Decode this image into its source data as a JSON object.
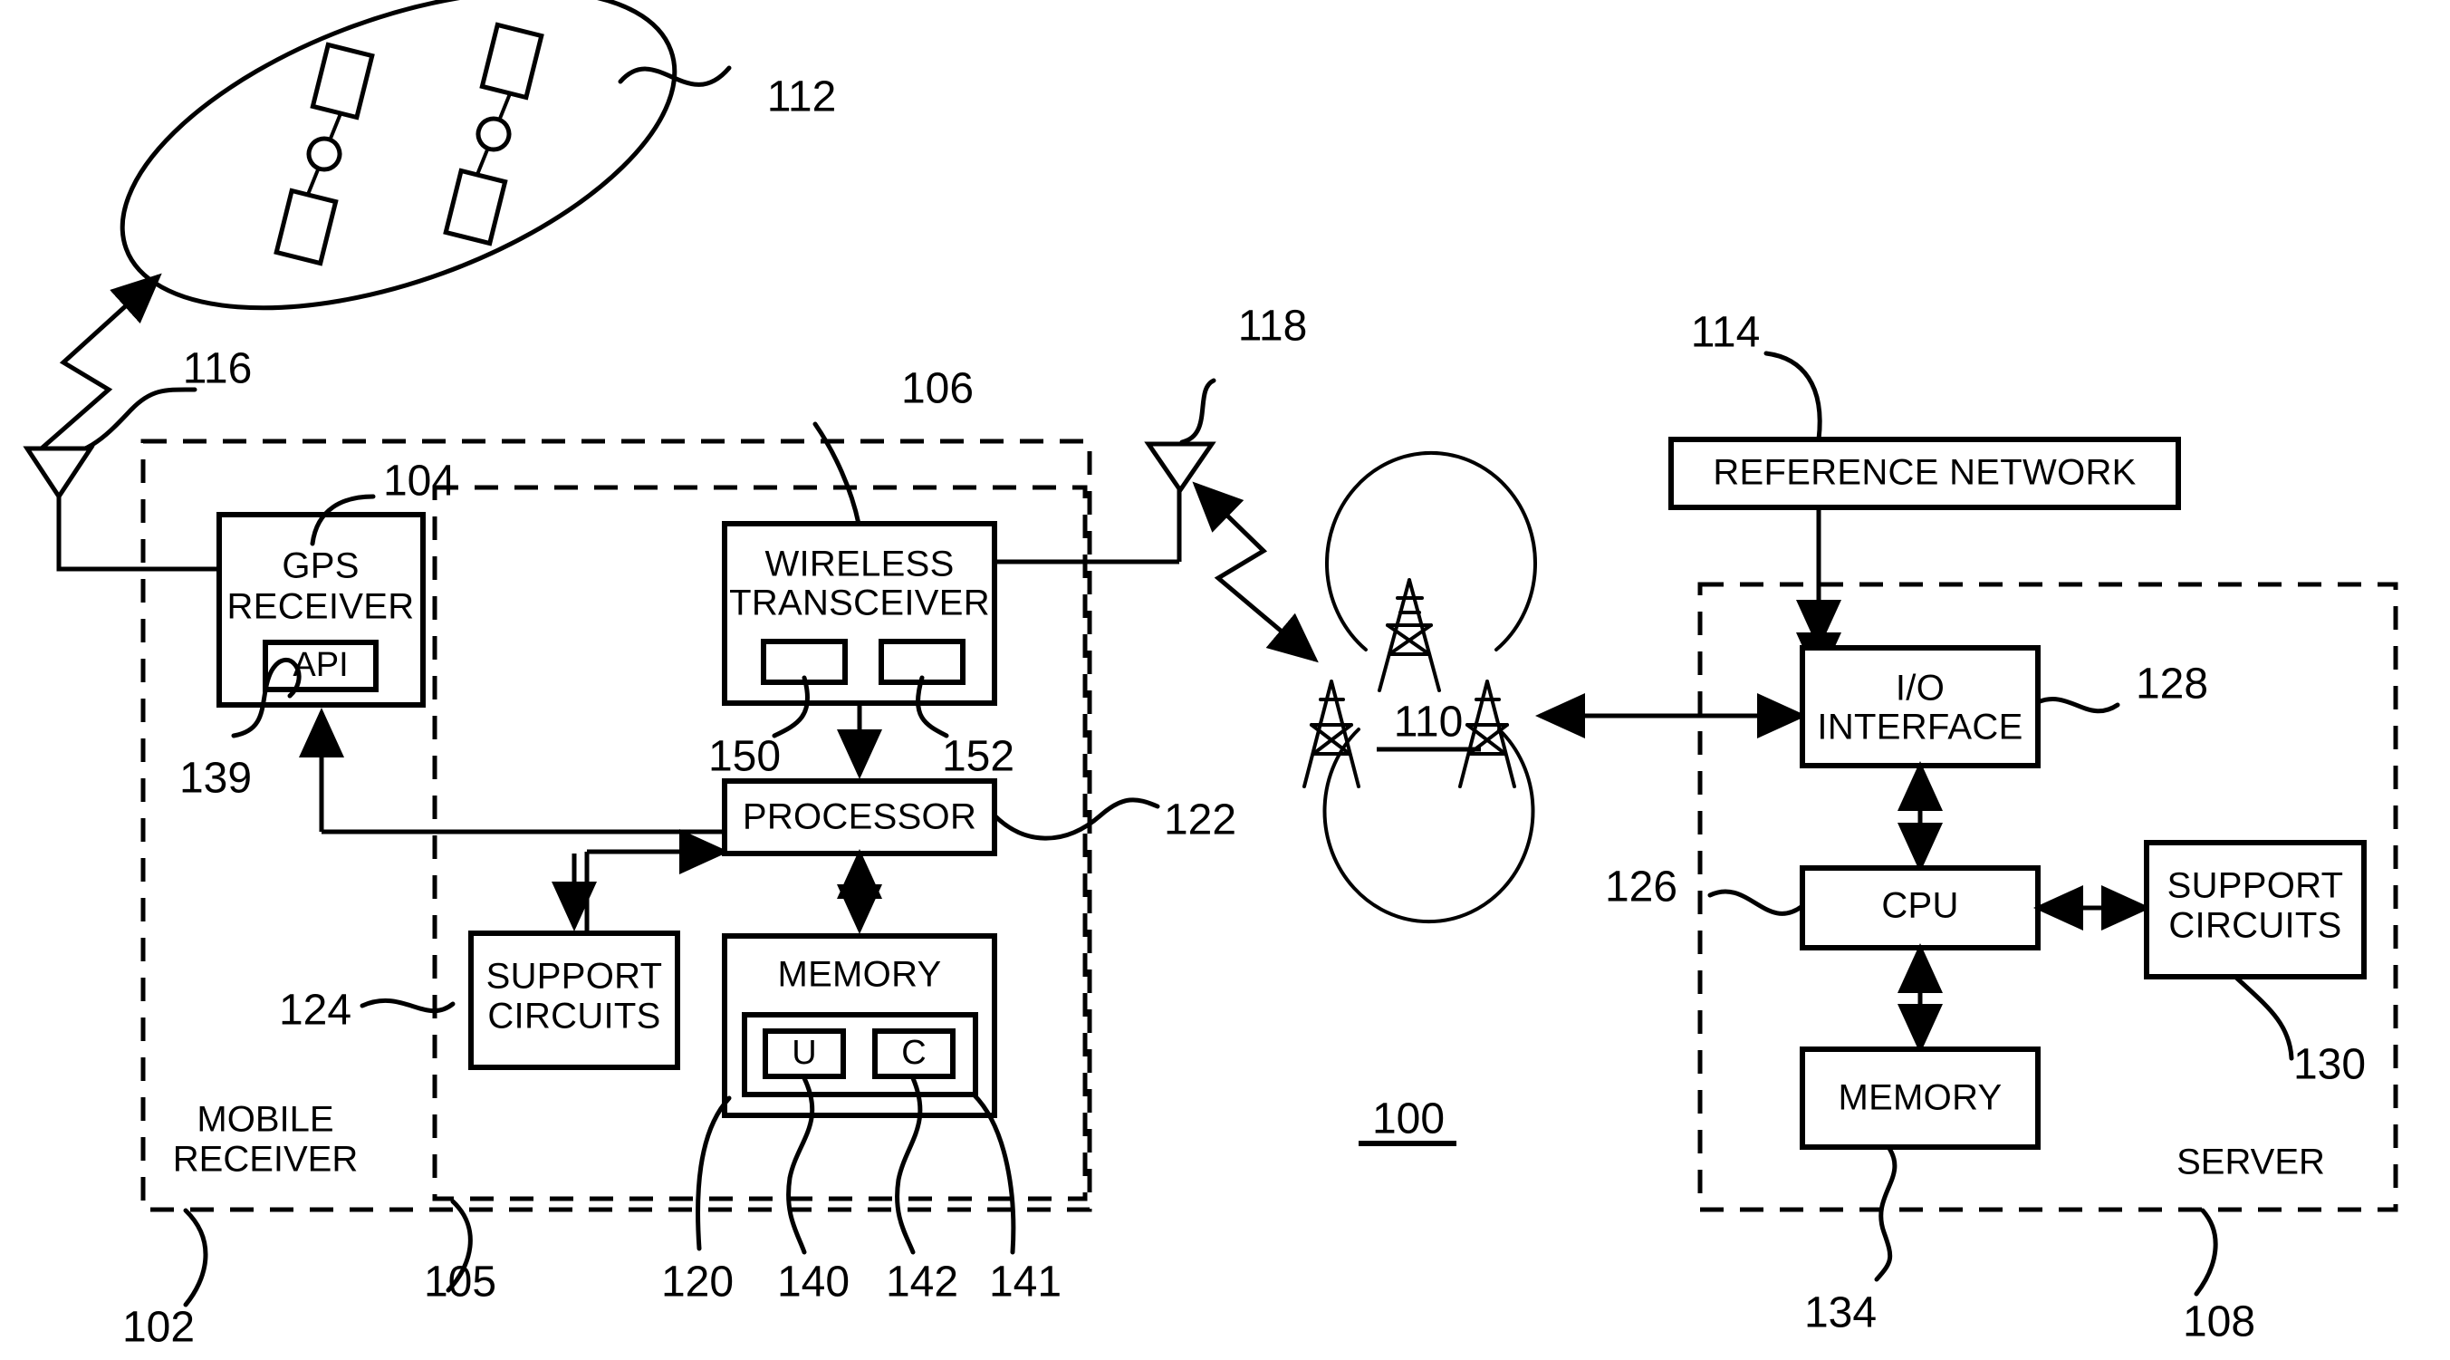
{
  "figure": {
    "title": "Satellite positioning system block diagram",
    "system_ref": "100",
    "stroke_color": "#000000",
    "background_color": "#ffffff"
  },
  "satellite_constellation": {
    "ref": "112",
    "satellite_count": 2
  },
  "signals": {
    "gps_signal_ref": "116",
    "wireless_signal_ref": "118"
  },
  "mobile_receiver": {
    "label_line1": "MOBILE",
    "label_line2": "RECEIVER",
    "ref": "102",
    "inner_group_ref": "105",
    "blocks": {
      "gps_receiver": {
        "label_line1": "GPS",
        "label_line2": "RECEIVER",
        "ref": "104",
        "api": {
          "label": "API",
          "ref": "139"
        }
      },
      "wireless_transceiver": {
        "label_line1": "WIRELESS",
        "label_line2": "TRANSCEIVER",
        "ref": "106",
        "sub_block_left_ref": "150",
        "sub_block_right_ref": "152"
      },
      "processor": {
        "label": "PROCESSOR",
        "ref": "122"
      },
      "support_circuits": {
        "label_line1": "SUPPORT",
        "label_line2": "CIRCUITS",
        "ref": "124"
      },
      "memory": {
        "label": "MEMORY",
        "ref": "120",
        "container_ref": "141",
        "cell_u": {
          "label": "U",
          "ref": "140"
        },
        "cell_c": {
          "label": "C",
          "ref": "142"
        }
      }
    }
  },
  "cellular_network": {
    "ref": "110",
    "tower_count": 3
  },
  "server": {
    "label": "SERVER",
    "ref": "108",
    "reference_network": {
      "label": "REFERENCE NETWORK",
      "ref": "114"
    },
    "blocks": {
      "io_interface": {
        "label_line1": "I/O",
        "label_line2": "INTERFACE",
        "ref": "128"
      },
      "cpu": {
        "label": "CPU",
        "ref": "126"
      },
      "support_circuits": {
        "label_line1": "SUPPORT",
        "label_line2": "CIRCUITS",
        "ref": "130"
      },
      "memory": {
        "label": "MEMORY",
        "ref": "134"
      }
    }
  }
}
